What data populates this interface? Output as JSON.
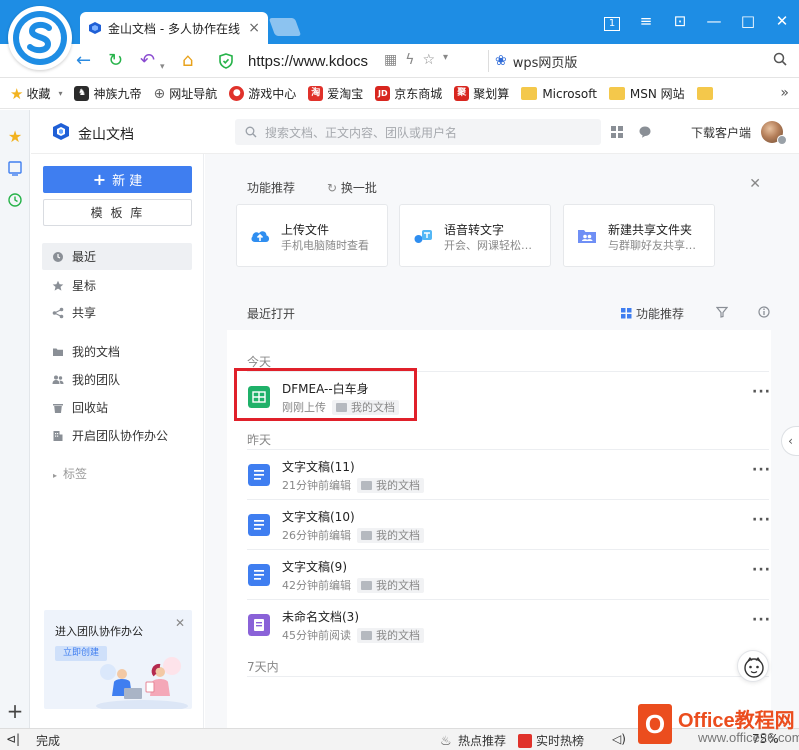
{
  "browser": {
    "tab_title": "金山文档 - 多人协作在线",
    "tab_close": "×",
    "url": "https://www.kdocs",
    "search_engine_text": "wps网页版",
    "window_buttons": [
      "1",
      "≡",
      "⊡",
      "—",
      "□",
      "✕"
    ]
  },
  "bookmarks": {
    "items": [
      {
        "label": "收藏",
        "icon": "star-icon",
        "color": "#f2b320"
      },
      {
        "label": "神族九帝",
        "icon": "game-icon",
        "color": "#2b2b2b"
      },
      {
        "label": "网址导航",
        "icon": "globe-icon",
        "color": "#666666"
      },
      {
        "label": "游戏中心",
        "icon": "game-center-icon",
        "color": "#e0322b"
      },
      {
        "label": "爱淘宝",
        "icon": "taobao-icon",
        "color": "#e0322b",
        "glyph": "淘"
      },
      {
        "label": "京东商城",
        "icon": "jd-icon",
        "color": "#d8261f",
        "glyph": "JD"
      },
      {
        "label": "聚划算",
        "icon": "juhuasuan-icon",
        "color": "#d8261f",
        "glyph": "聚"
      },
      {
        "label": "Microsoft",
        "icon": "folder-icon"
      },
      {
        "label": "MSN 网站",
        "icon": "folder-icon"
      },
      {
        "label": "",
        "icon": "folder-icon"
      }
    ],
    "more": "»"
  },
  "app": {
    "name": "金山文档",
    "search_placeholder": "搜索文档、正文内容、团队或用户名",
    "download_client": "下载客户端"
  },
  "nav": {
    "new_label": "新 建",
    "template_label": "模 板 库",
    "items": [
      {
        "label": "最近",
        "icon": "clock-icon",
        "active": true
      },
      {
        "label": "星标",
        "icon": "star-icon"
      },
      {
        "label": "共享",
        "icon": "share-icon"
      },
      {
        "label": "我的文档",
        "icon": "folder-icon"
      },
      {
        "label": "我的团队",
        "icon": "team-icon"
      },
      {
        "label": "回收站",
        "icon": "trash-icon"
      },
      {
        "label": "开启团队协作办公",
        "icon": "building-icon"
      }
    ],
    "tags_label": "标签",
    "promo_title": "进入团队协作办公",
    "promo_button": "立即创建"
  },
  "recommend": {
    "title": "功能推荐",
    "refresh": "换一批",
    "cards": [
      {
        "title": "上传文件",
        "subtitle": "手机电脑随时查看",
        "icon": "cloud-upload-icon"
      },
      {
        "title": "语音转文字",
        "subtitle": "开会、网课轻松…",
        "icon": "voice-to-text-icon"
      },
      {
        "title": "新建共享文件夹",
        "subtitle": "与群聊好友共享…",
        "icon": "shared-folder-icon"
      }
    ]
  },
  "recent": {
    "title": "最近打开",
    "function_recommend": "功能推荐",
    "groups": [
      {
        "label": "今天",
        "files": [
          {
            "name": "DFMEA--白车身",
            "meta": "刚刚上传",
            "location": "我的文档",
            "type": "sheet",
            "color": "#1fb169"
          }
        ]
      },
      {
        "label": "昨天",
        "files": [
          {
            "name": "文字文稿(11)",
            "meta": "21分钟前编辑",
            "location": "我的文档",
            "type": "doc",
            "color": "#3f7ef0"
          },
          {
            "name": "文字文稿(10)",
            "meta": "26分钟前编辑",
            "location": "我的文档",
            "type": "doc",
            "color": "#3f7ef0"
          },
          {
            "name": "文字文稿(9)",
            "meta": "42分钟前编辑",
            "location": "我的文档",
            "type": "doc",
            "color": "#3f7ef0"
          },
          {
            "name": "未命名文档(3)",
            "meta": "45分钟前阅读",
            "location": "我的文档",
            "type": "note",
            "color": "#8a62d8"
          }
        ]
      },
      {
        "label": "7天内",
        "files": []
      }
    ]
  },
  "statusbar": {
    "left": "完成",
    "hot_search": "热点推荐",
    "realtime_hot": "实时热榜",
    "zoom": "75%"
  },
  "watermark": {
    "brand": "Office教程网",
    "domain": "www.office26.com"
  }
}
